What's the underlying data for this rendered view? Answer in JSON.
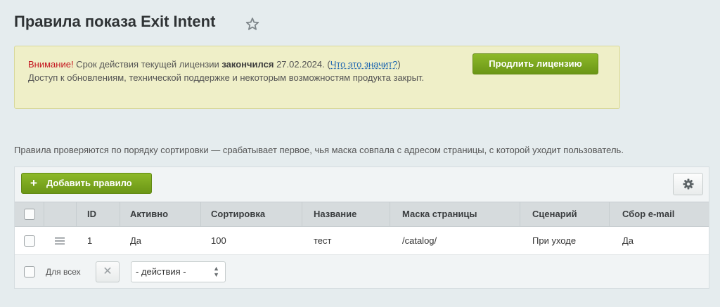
{
  "page": {
    "title": "Правила показа Exit Intent"
  },
  "license_notice": {
    "warning": "Внимание!",
    "text_before": " Срок действия текущей лицензии ",
    "bold": "закончился",
    "date_text": " 27.02.2024. (",
    "link": "Что это значит?",
    "after_link": ")",
    "line2": "Доступ к обновлениям, технической поддержке и некоторым возможностям продукта закрыт.",
    "renew_button": "Продлить лицензию",
    "accent_color": "#7aa51d"
  },
  "info_text": "Правила проверяются по порядку сортировки — срабатывает первое, чья маска совпала с адресом страницы, с которой уходит пользователь.",
  "toolbar": {
    "add_rule_button": "Добавить правило",
    "settings_icon": "gear-icon"
  },
  "table": {
    "columns": [
      "ID",
      "Активно",
      "Сортировка",
      "Название",
      "Маска страницы",
      "Сценарий",
      "Сбор e-mail"
    ],
    "rows": [
      [
        "1",
        "Да",
        "100",
        "тест",
        "/catalog/",
        "При уходе",
        "Да"
      ]
    ]
  },
  "footer": {
    "for_all_label": "Для всех",
    "actions_select": "- действия -"
  }
}
